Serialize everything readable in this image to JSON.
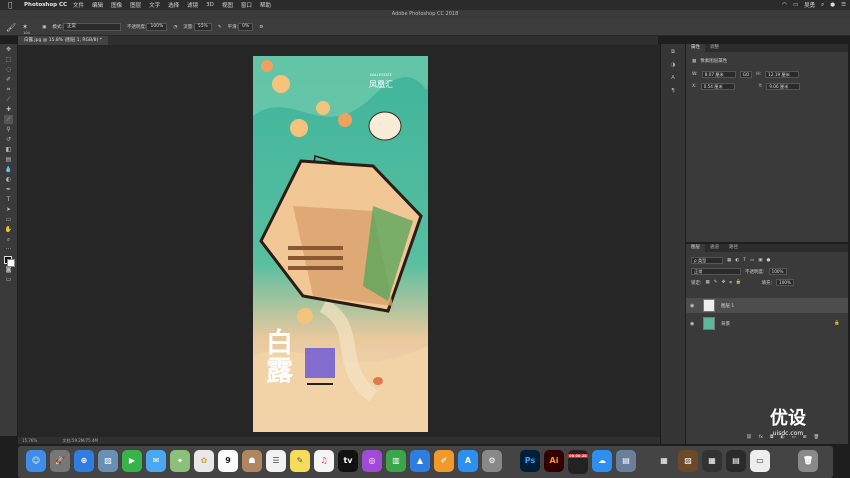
{
  "menubar": {
    "app": "Photoshop CC",
    "items": [
      "文件",
      "编辑",
      "图像",
      "图层",
      "文字",
      "选择",
      "滤镜",
      "3D",
      "视图",
      "窗口",
      "帮助"
    ],
    "user": "吴勇"
  },
  "window": {
    "title": "Adobe Photoshop CC 2018"
  },
  "options": {
    "mode_label": "模式:",
    "mode_value": "正常",
    "opacity_label": "不透明度:",
    "opacity_value": "100%",
    "flow_label": "流量:",
    "flow_value": "55%",
    "smooth_label": "平滑:",
    "smooth_value": "0%",
    "brush_size": "104"
  },
  "document": {
    "tab": "白露.jpg @ 15.8% (图层 1, RGB/8) *",
    "zoom": "15.76%",
    "doc_info": "文档:59.2M/75.4M"
  },
  "properties": {
    "tabs": [
      "属性",
      "调整"
    ],
    "section": "像素图层属性",
    "w_label": "W:",
    "w_value": "8.07 厘米",
    "h_label": "H:",
    "h_value": "12.19 厘米",
    "x_label": "X:",
    "x_value": "0.54 厘米",
    "y_label": "Y:",
    "y_value": "9.06 厘米",
    "link": "GO"
  },
  "layers": {
    "tabs": [
      "图层",
      "通道",
      "路径"
    ],
    "filter": "ρ 类型",
    "blend": "正常",
    "opacity_label": "不透明度:",
    "opacity_value": "100%",
    "lock_label": "锁定:",
    "fill_label": "填充:",
    "fill_value": "100%",
    "items": [
      {
        "name": "图层 1",
        "selected": true
      },
      {
        "name": "背景",
        "selected": false
      }
    ]
  },
  "artwork": {
    "brand_en": "DALI ESTATE",
    "brand_cn": "凤凰汇",
    "title": "白露"
  },
  "watermark": {
    "cn": "优设",
    "url": "uisdc.com"
  },
  "dock": {
    "ps": "Ps",
    "ai": "Ai",
    "calendar_day": "9",
    "recorder": "00:00:28"
  },
  "colors": {
    "teal": "#3fb49a",
    "cream": "#f3d9b1",
    "ps_blue": "#31a8ff",
    "ai_orange": "#ff9a00"
  }
}
